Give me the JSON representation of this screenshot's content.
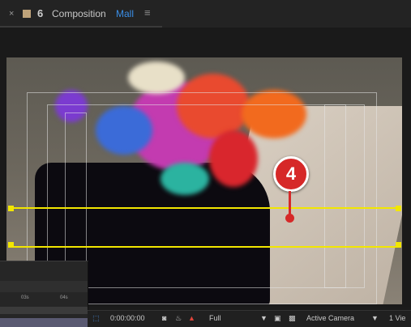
{
  "tab": {
    "close_glyph": "×",
    "lock_glyph": "6",
    "label_prefix": "Composition",
    "label_name": "Mall",
    "menu_glyph": "≡"
  },
  "annotation": {
    "callout_number": "4"
  },
  "timeline": {
    "ticks": [
      "03s",
      "04s"
    ]
  },
  "toolbar": {
    "timecode": "0:00:00:00",
    "resolution": "Full",
    "camera": "Active Camera",
    "views": "1 Vie"
  },
  "colors": {
    "selection": "#f2e600",
    "callout": "#d62828",
    "accent": "#3a8ee6"
  },
  "icons": [
    "close-icon",
    "color-swatch-icon",
    "lock-icon",
    "panel-menu-icon",
    "region-of-interest-icon",
    "snapshot-icon",
    "show-snapshot-icon",
    "channel-icon",
    "toggle-transparency-grid-icon",
    "mask-icon",
    "dropdown-icon"
  ]
}
